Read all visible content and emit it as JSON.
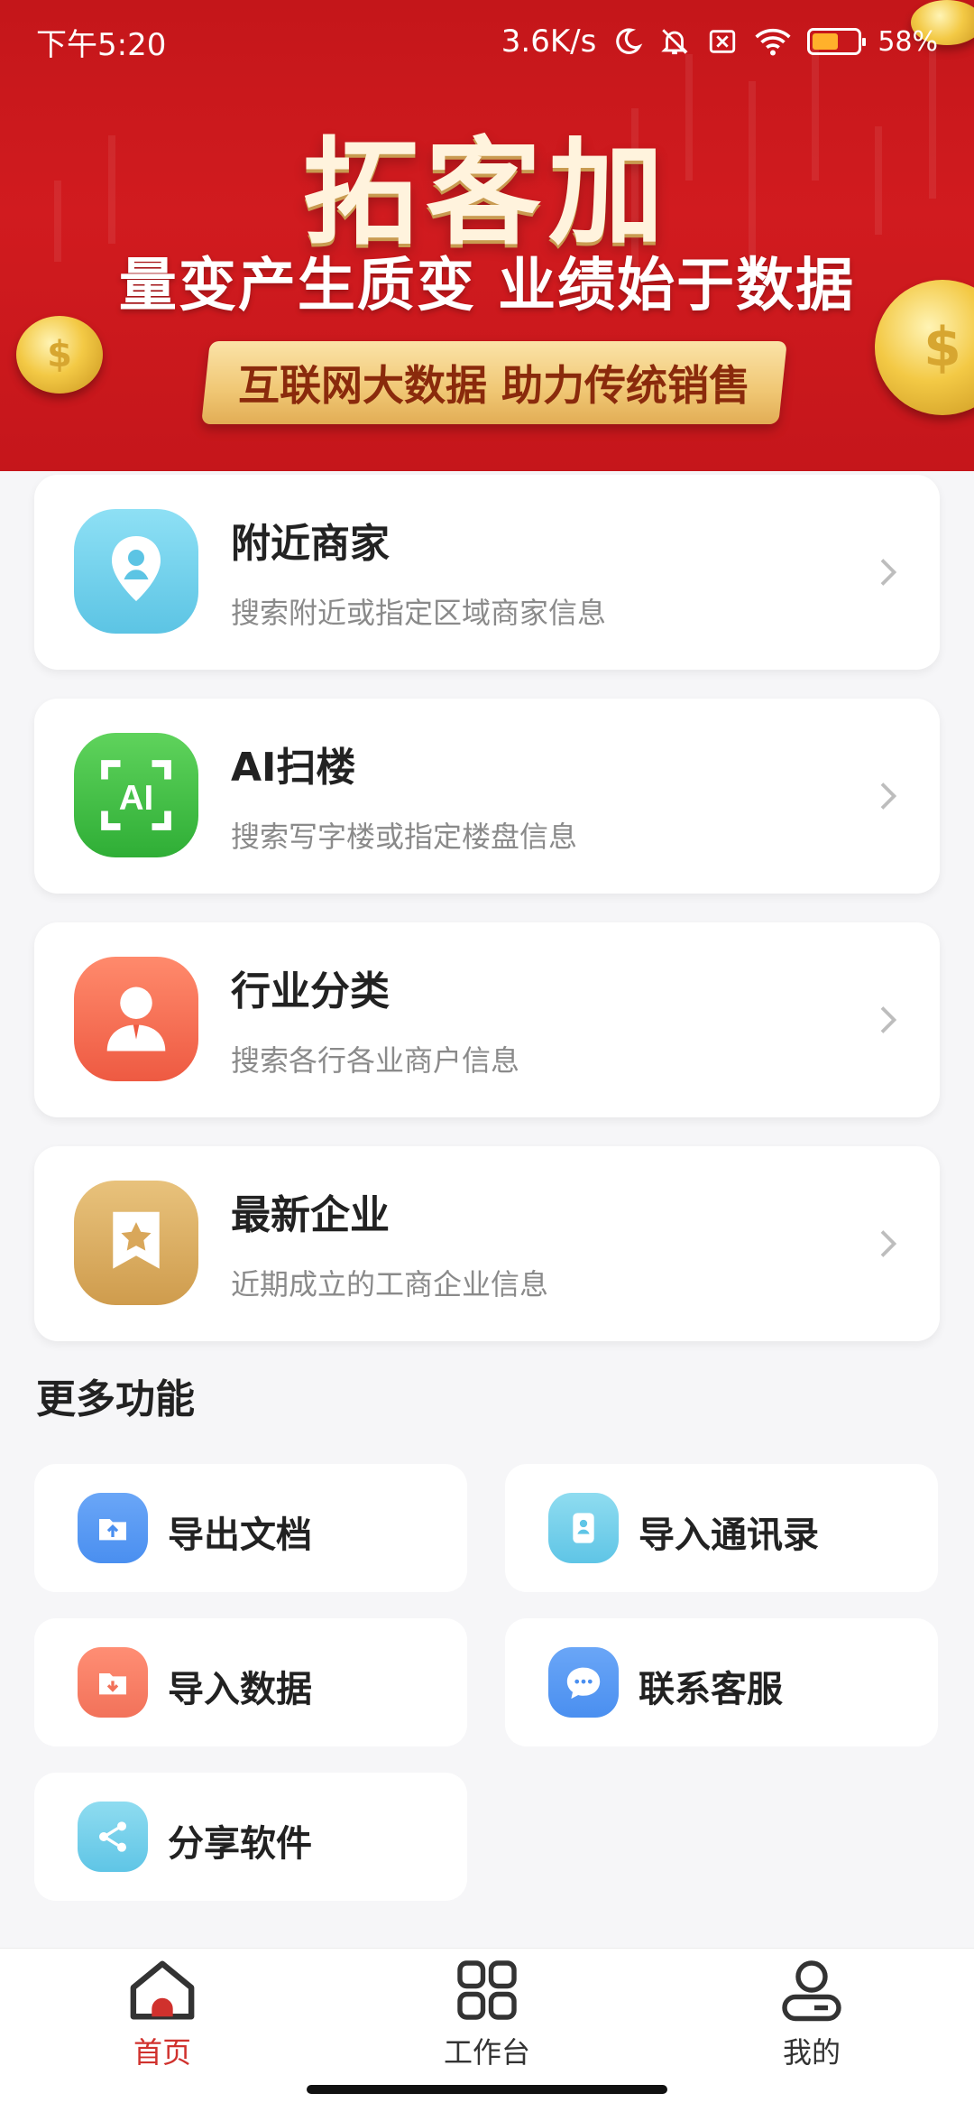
{
  "status": {
    "time": "下午5:20",
    "speed": "3.6K/s",
    "battery": "58%"
  },
  "banner": {
    "title": "拓客加",
    "subtitle": "量变产生质变 业绩始于数据",
    "ribbon": "互联网大数据 助力传统销售"
  },
  "features": [
    {
      "title": "附近商家",
      "desc": "搜索附近或指定区域商家信息",
      "icon": "location-pin-icon"
    },
    {
      "title": "AI扫楼",
      "desc": "搜索写字楼或指定楼盘信息",
      "icon": "ai-scan-icon"
    },
    {
      "title": "行业分类",
      "desc": "搜索各行各业商户信息",
      "icon": "person-icon"
    },
    {
      "title": "最新企业",
      "desc": "近期成立的工商企业信息",
      "icon": "star-badge-icon"
    }
  ],
  "more": {
    "title": "更多功能",
    "items": [
      {
        "label": "导出文档",
        "icon": "export-doc-icon",
        "color": "#4a8ff0"
      },
      {
        "label": "导入通讯录",
        "icon": "contacts-icon",
        "color": "#5fc5e6"
      },
      {
        "label": "导入数据",
        "icon": "import-data-icon",
        "color": "#f2725a"
      },
      {
        "label": "联系客服",
        "icon": "chat-icon",
        "color": "#4a8ff0"
      },
      {
        "label": "分享软件",
        "icon": "share-icon",
        "color": "#5fc5e6"
      }
    ]
  },
  "tabs": [
    {
      "label": "首页",
      "icon": "home-icon",
      "active": true
    },
    {
      "label": "工作台",
      "icon": "grid-icon",
      "active": false
    },
    {
      "label": "我的",
      "icon": "profile-icon",
      "active": false
    }
  ],
  "colors": {
    "accent": "#d11b1f",
    "active_tab": "#d0312d",
    "inactive_tab": "#333333"
  }
}
